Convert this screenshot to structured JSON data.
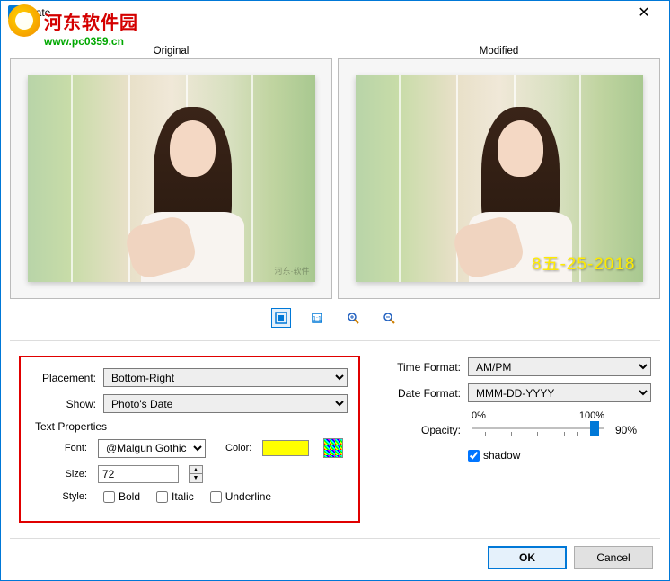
{
  "window": {
    "title": "Date"
  },
  "watermark": {
    "brand": "河东软件园",
    "url": "www.pc0359.cn"
  },
  "previews": {
    "original_label": "Original",
    "modified_label": "Modified",
    "date_stamp": "8五-25-2018",
    "mini_watermark": "河东·软件"
  },
  "toolbar": {
    "fit_icon": "fit-screen",
    "actual_icon": "actual-size",
    "zoom_in_icon": "zoom-in",
    "zoom_out_icon": "zoom-out"
  },
  "form": {
    "placement_label": "Placement:",
    "placement_value": "Bottom-Right",
    "show_label": "Show:",
    "show_value": "Photo's Date",
    "text_properties_label": "Text Properties",
    "font_label": "Font:",
    "font_value": "@Malgun Gothic",
    "color_label": "Color:",
    "color_value": "#ffff00",
    "size_label": "Size:",
    "size_value": "72",
    "style_label": "Style:",
    "bold_label": "Bold",
    "italic_label": "Italic",
    "underline_label": "Underline",
    "bold_checked": false,
    "italic_checked": false,
    "underline_checked": false,
    "time_format_label": "Time Format:",
    "time_format_value": "AM/PM",
    "date_format_label": "Date Format:",
    "date_format_value": "MMM-DD-YYYY",
    "opacity_label": "Opacity:",
    "opacity_min": "0%",
    "opacity_max": "100%",
    "opacity_value": "90%",
    "shadow_label": "shadow",
    "shadow_checked": true
  },
  "buttons": {
    "ok": "OK",
    "cancel": "Cancel"
  }
}
